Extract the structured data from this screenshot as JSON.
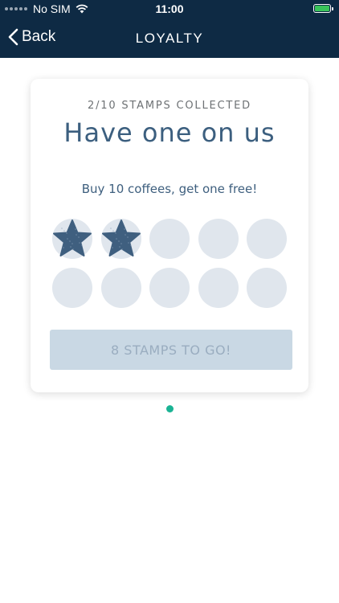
{
  "status_bar": {
    "carrier": "No SIM",
    "time": "11:00"
  },
  "nav": {
    "back_label": "Back",
    "title": "LOYALTY"
  },
  "card": {
    "progress_label": "2/10 STAMPS COLLECTED",
    "headline": "Have one on us",
    "subtitle": "Buy 10 coffees, get one free!",
    "stamps_collected": 2,
    "stamps_total": 10,
    "button_label": "8 STAMPS TO GO!"
  },
  "colors": {
    "nav_bg": "#0e2a44",
    "stamp_star": "#3f5f7f",
    "stamp_empty": "#e0e6ed",
    "button_bg": "#c9d8e4",
    "page_indicator": "#1ab394"
  },
  "icons": [
    "back-chevron-icon",
    "wifi-icon",
    "battery-icon",
    "star-stamp-icon"
  ]
}
